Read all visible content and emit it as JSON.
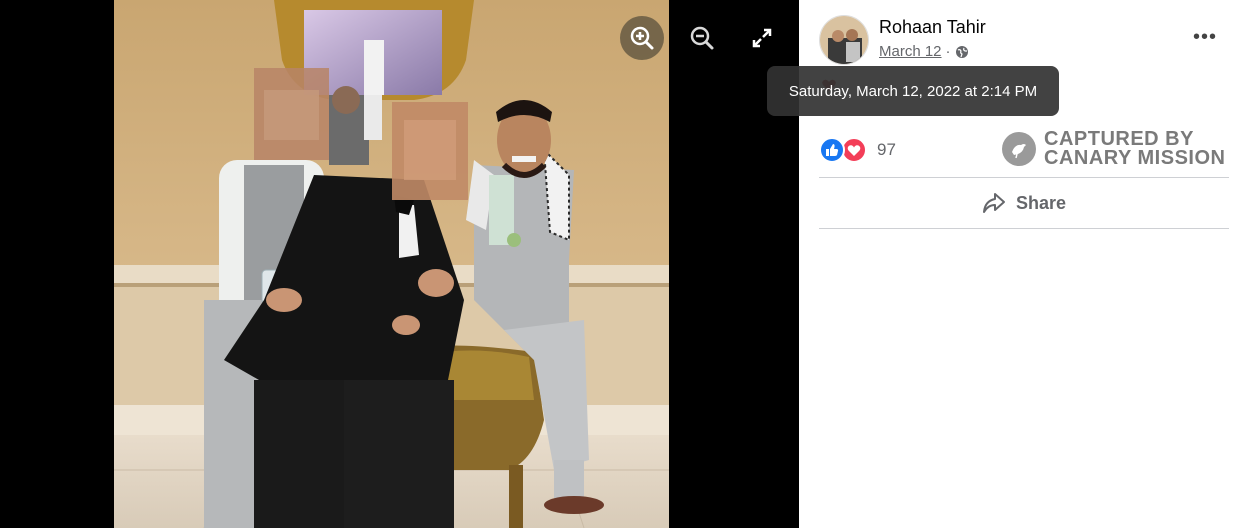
{
  "viewer": {
    "controls": {
      "zoom_in_icon": "zoom-in-icon",
      "zoom_out_icon": "zoom-out-icon",
      "fullscreen_icon": "fullscreen-icon"
    },
    "background_color": "#000000"
  },
  "post": {
    "author": "Rohaan Tahir",
    "date": "March 12",
    "separator": "·",
    "audience_icon": "globe-icon",
    "more_icon": "more-icon",
    "more_label": "•••",
    "tooltip": "Saturday, March 12, 2022 at 2:14 PM",
    "reactions": {
      "types": [
        "like",
        "love"
      ],
      "count": "97",
      "like_color": "#1877f2",
      "love_color": "#f33e58"
    },
    "share_label": "Share",
    "share_icon": "share-arrow-icon"
  },
  "watermark": {
    "line1": "CAPTURED BY",
    "line2": "CANARY MISSION",
    "logo_icon": "canary-bird-icon"
  }
}
